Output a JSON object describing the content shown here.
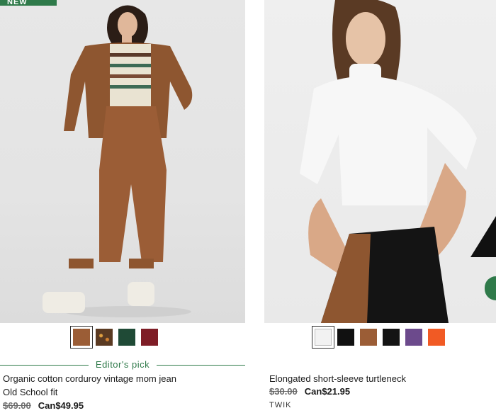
{
  "products": [
    {
      "badge": "NEW",
      "title": "Organic cotton corduroy vintage mom jean",
      "fit": "Old School fit",
      "old_price": "$69.00",
      "new_price": "Can$49.95",
      "editors_pick": "Editor's pick",
      "swatches": [
        {
          "color": "#9b5d36",
          "selected": true
        },
        {
          "color": "#5a3a22",
          "pattern": "floral"
        },
        {
          "color": "#1f4a36"
        },
        {
          "color": "#7e1d26"
        }
      ]
    },
    {
      "title": "Elongated short-sleeve turtleneck",
      "old_price": "$30.00",
      "new_price": "Can$21.95",
      "brand": "TWIK",
      "swatches": [
        {
          "color": "#f2f2f2",
          "selected": true
        },
        {
          "color": "#111111"
        },
        {
          "color": "#9b5d36"
        },
        {
          "color": "#141414"
        },
        {
          "color": "#6c4a8c"
        },
        {
          "color": "#f15a24"
        }
      ]
    }
  ],
  "colors": {
    "accent_green": "#2f7a4a"
  }
}
